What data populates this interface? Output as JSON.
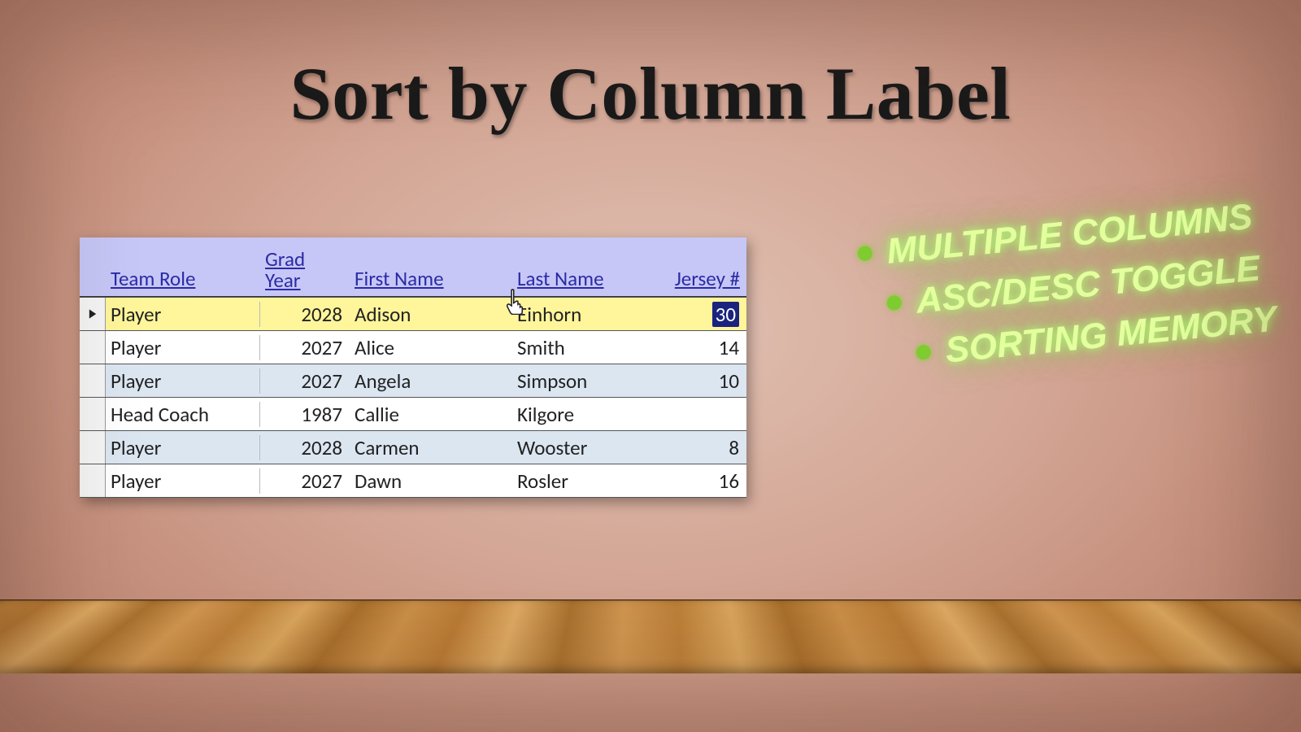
{
  "title": "Sort by Column Label",
  "bullets": {
    "items": [
      "Multiple Columns",
      "ASC/DESC Toggle",
      "Sorting Memory"
    ]
  },
  "table": {
    "headers": {
      "team_role": "Team Role",
      "grad_year_line1": "Grad",
      "grad_year_line2": "Year",
      "first_name": "First Name",
      "last_name": "Last Name",
      "jersey": "Jersey #"
    },
    "rows": [
      {
        "team_role": "Player",
        "grad_year": "2028",
        "first_name": "Adison",
        "last_name": "Einhorn",
        "jersey": "30",
        "highlight": true,
        "selected": true
      },
      {
        "team_role": "Player",
        "grad_year": "2027",
        "first_name": "Alice",
        "last_name": "Smith",
        "jersey": "14"
      },
      {
        "team_role": "Player",
        "grad_year": "2027",
        "first_name": "Angela",
        "last_name": "Simpson",
        "jersey": "10",
        "alt": true
      },
      {
        "team_role": "Head Coach",
        "grad_year": "1987",
        "first_name": "Callie",
        "last_name": "Kilgore",
        "jersey": ""
      },
      {
        "team_role": "Player",
        "grad_year": "2028",
        "first_name": "Carmen",
        "last_name": "Wooster",
        "jersey": "8",
        "alt": true
      },
      {
        "team_role": "Player",
        "grad_year": "2027",
        "first_name": "Dawn",
        "last_name": "Rosler",
        "jersey": "16"
      }
    ]
  }
}
